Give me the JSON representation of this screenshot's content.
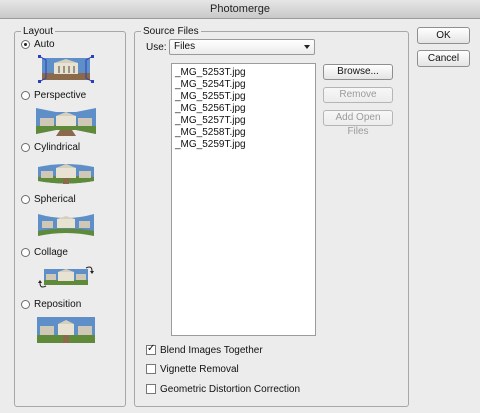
{
  "window": {
    "title": "Photomerge"
  },
  "layout": {
    "legend": "Layout",
    "options": [
      {
        "label": "Auto",
        "checked": true,
        "icon": "auto-layout-icon"
      },
      {
        "label": "Perspective",
        "checked": false,
        "icon": "perspective-layout-icon"
      },
      {
        "label": "Cylindrical",
        "checked": false,
        "icon": "cylindrical-layout-icon"
      },
      {
        "label": "Spherical",
        "checked": false,
        "icon": "spherical-layout-icon"
      },
      {
        "label": "Collage",
        "checked": false,
        "icon": "collage-layout-icon"
      },
      {
        "label": "Reposition",
        "checked": false,
        "icon": "reposition-layout-icon"
      }
    ]
  },
  "source": {
    "legend": "Source Files",
    "use_label": "Use:",
    "use_value": "Files",
    "files": [
      "_MG_5253T.jpg",
      "_MG_5254T.jpg",
      "_MG_5255T.jpg",
      "_MG_5256T.jpg",
      "_MG_5257T.jpg",
      "_MG_5258T.jpg",
      "_MG_5259T.jpg"
    ],
    "browse_label": "Browse...",
    "remove_label": "Remove",
    "add_open_label": "Add Open Files"
  },
  "options": {
    "blend": {
      "label": "Blend Images Together",
      "checked": true
    },
    "vignette": {
      "label": "Vignette Removal",
      "checked": false
    },
    "distortion": {
      "label": "Geometric Distortion Correction",
      "checked": false
    }
  },
  "buttons": {
    "ok_label": "OK",
    "cancel_label": "Cancel"
  },
  "colors": {
    "sky": "#5f8fc9",
    "building": "#e8e2d2",
    "ground": "#8a6a4a",
    "grass": "#5f8a3a"
  }
}
